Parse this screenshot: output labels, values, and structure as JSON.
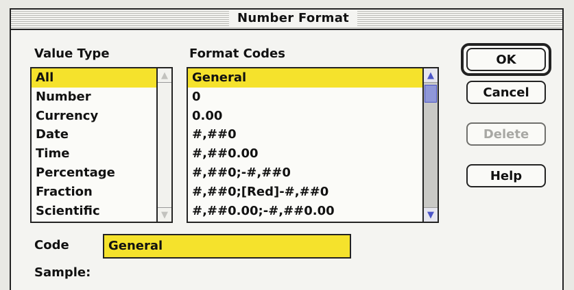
{
  "dialog": {
    "title": "Number Format"
  },
  "value_type": {
    "label": "Value Type",
    "items": [
      {
        "label": "All",
        "selected": true
      },
      {
        "label": "Number"
      },
      {
        "label": "Currency"
      },
      {
        "label": "Date"
      },
      {
        "label": "Time"
      },
      {
        "label": "Percentage"
      },
      {
        "label": "Fraction"
      },
      {
        "label": "Scientific"
      }
    ]
  },
  "format_codes": {
    "label": "Format Codes",
    "items": [
      {
        "label": "General",
        "selected": true
      },
      {
        "label": "0"
      },
      {
        "label": "0.00"
      },
      {
        "label": "#,##0"
      },
      {
        "label": "#,##0.00"
      },
      {
        "label": "#,##0;-#,##0"
      },
      {
        "label": "#,##0;[Red]-#,##0"
      },
      {
        "label": "#,##0.00;-#,##0.00"
      }
    ]
  },
  "buttons": {
    "ok": "OK",
    "cancel": "Cancel",
    "delete": "Delete",
    "help": "Help"
  },
  "code": {
    "label": "Code",
    "value": "General"
  },
  "sample": {
    "label": "Sample:"
  },
  "colors": {
    "selection": "#f5e22c",
    "scroll_arrow": "#4c55c8"
  },
  "icons": {
    "scroll_up": "scroll-up-arrow-icon",
    "scroll_down": "scroll-down-arrow-icon"
  }
}
